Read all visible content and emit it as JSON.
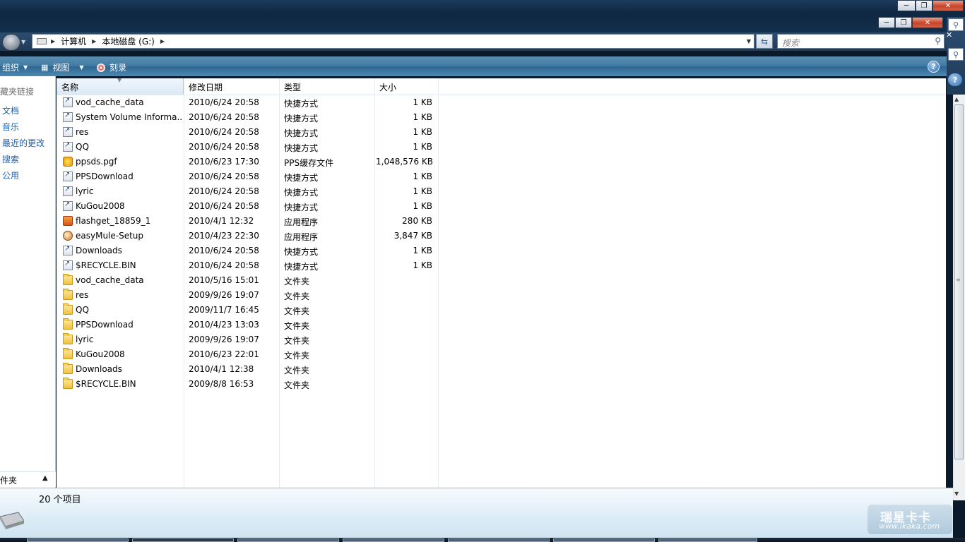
{
  "window": {
    "caption_buttons": {
      "minimize": "─",
      "maximize": "❐",
      "close": "✕"
    }
  },
  "address": {
    "crumbs": [
      "计算机",
      "本地磁盘 (G:)"
    ],
    "search_placeholder": "搜索"
  },
  "toolbar": {
    "organize_label": "组织",
    "view_label": "视图",
    "burn_label": "刻录",
    "help_label": "?"
  },
  "nav": {
    "favorites_title": "藏夹链接",
    "links": [
      "文档",
      "音乐",
      "最近的更改",
      "搜索",
      "公用"
    ],
    "folders_label": "件夹"
  },
  "columns": {
    "name": "名称",
    "date": "修改日期",
    "type": "类型",
    "size": "大小"
  },
  "files": [
    {
      "name": "vod_cache_data",
      "date": "2010/6/24 20:58",
      "type": "快捷方式",
      "size": "1 KB",
      "icon": "shortcut-icon"
    },
    {
      "name": "System Volume Informa...",
      "date": "2010/6/24 20:58",
      "type": "快捷方式",
      "size": "1 KB",
      "icon": "shortcut-icon"
    },
    {
      "name": "res",
      "date": "2010/6/24 20:58",
      "type": "快捷方式",
      "size": "1 KB",
      "icon": "shortcut-icon"
    },
    {
      "name": "QQ",
      "date": "2010/6/24 20:58",
      "type": "快捷方式",
      "size": "1 KB",
      "icon": "shortcut-icon"
    },
    {
      "name": "ppsds.pgf",
      "date": "2010/6/23 17:30",
      "type": "PPS缓存文件",
      "size": "1,048,576 KB",
      "icon": "pps-file-icon"
    },
    {
      "name": "PPSDownload",
      "date": "2010/6/24 20:58",
      "type": "快捷方式",
      "size": "1 KB",
      "icon": "shortcut-icon"
    },
    {
      "name": "lyric",
      "date": "2010/6/24 20:58",
      "type": "快捷方式",
      "size": "1 KB",
      "icon": "shortcut-icon"
    },
    {
      "name": "KuGou2008",
      "date": "2010/6/24 20:58",
      "type": "快捷方式",
      "size": "1 KB",
      "icon": "shortcut-icon"
    },
    {
      "name": "flashget_18859_1",
      "date": "2010/4/1 12:32",
      "type": "应用程序",
      "size": "280 KB",
      "icon": "app-icon"
    },
    {
      "name": "easyMule-Setup",
      "date": "2010/4/23 22:30",
      "type": "应用程序",
      "size": "3,847 KB",
      "icon": "mule-app-icon"
    },
    {
      "name": "Downloads",
      "date": "2010/6/24 20:58",
      "type": "快捷方式",
      "size": "1 KB",
      "icon": "shortcut-icon"
    },
    {
      "name": "$RECYCLE.BIN",
      "date": "2010/6/24 20:58",
      "type": "快捷方式",
      "size": "1 KB",
      "icon": "shortcut-icon"
    },
    {
      "name": "vod_cache_data",
      "date": "2010/5/16 15:01",
      "type": "文件夹",
      "size": "",
      "icon": "folder-icon"
    },
    {
      "name": "res",
      "date": "2009/9/26 19:07",
      "type": "文件夹",
      "size": "",
      "icon": "folder-icon"
    },
    {
      "name": "QQ",
      "date": "2009/11/7 16:45",
      "type": "文件夹",
      "size": "",
      "icon": "folder-icon"
    },
    {
      "name": "PPSDownload",
      "date": "2010/4/23 13:03",
      "type": "文件夹",
      "size": "",
      "icon": "folder-icon"
    },
    {
      "name": "lyric",
      "date": "2009/9/26 19:07",
      "type": "文件夹",
      "size": "",
      "icon": "folder-icon"
    },
    {
      "name": "KuGou2008",
      "date": "2010/6/23 22:01",
      "type": "文件夹",
      "size": "",
      "icon": "folder-icon"
    },
    {
      "name": "Downloads",
      "date": "2010/4/1 12:38",
      "type": "文件夹",
      "size": "",
      "icon": "folder-icon"
    },
    {
      "name": "$RECYCLE.BIN",
      "date": "2009/8/8 16:53",
      "type": "文件夹",
      "size": "",
      "icon": "folder-icon"
    }
  ],
  "status": {
    "item_count": "20 个项目"
  },
  "watermark": {
    "brand": "瑞星卡卡",
    "url": "www.ikaka.com"
  },
  "colors": {
    "link": "#1a5fb4",
    "toolbar": "#3f7aa3",
    "close_button": "#c7432a"
  }
}
